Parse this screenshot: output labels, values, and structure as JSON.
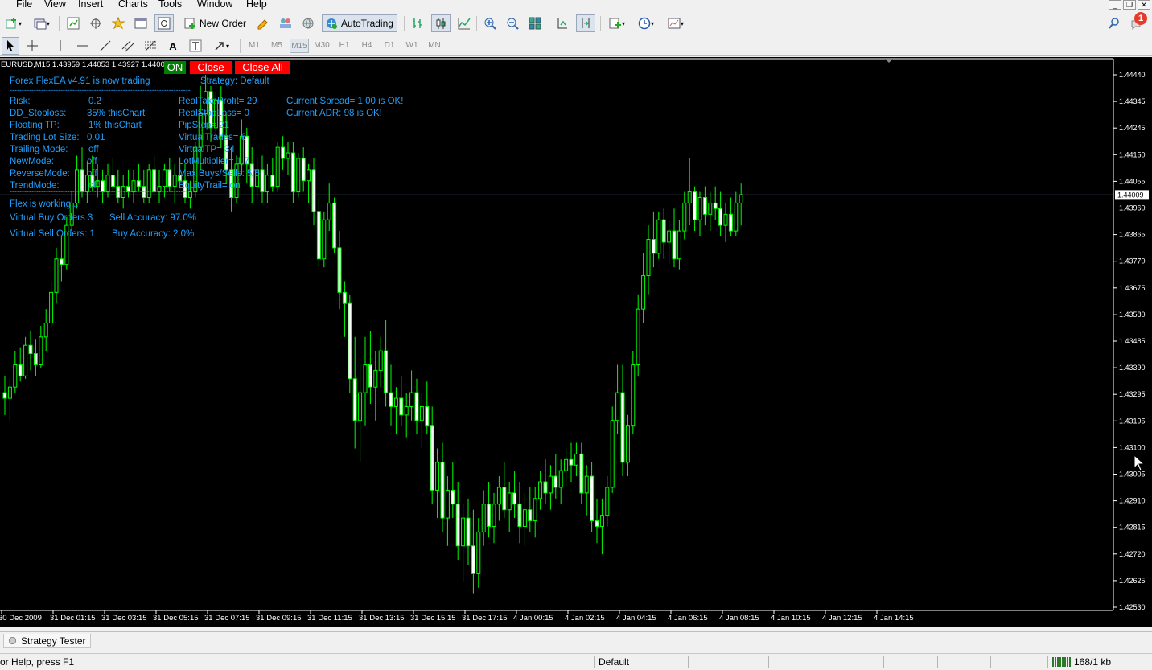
{
  "menu": [
    "File",
    "View",
    "Insert",
    "Charts",
    "Tools",
    "Window",
    "Help"
  ],
  "toolbar": {
    "new_order": "New Order",
    "autotrading": "AutoTrading",
    "timeframes": [
      "M1",
      "M5",
      "M15",
      "M30",
      "H1",
      "H4",
      "D1",
      "W1",
      "MN"
    ],
    "active_timeframe": "M15",
    "notification_count": "1"
  },
  "chart": {
    "header": "EURUSD,M15  1.43959 1.44053 1.43927 1.4400",
    "current_price": "1.44009",
    "price_labels": [
      "1.44440",
      "1.44345",
      "1.44245",
      "1.44150",
      "1.44055",
      "1.43960",
      "1.43865",
      "1.43770",
      "1.43675",
      "1.43580",
      "1.43485",
      "1.43390",
      "1.43295",
      "1.43195",
      "1.43100",
      "1.43005",
      "1.42910",
      "1.42815",
      "1.42720",
      "1.42625",
      "1.42530"
    ],
    "time_labels": [
      "30 Dec 2009",
      "31 Dec 01:15",
      "31 Dec 03:15",
      "31 Dec 05:15",
      "31 Dec 07:15",
      "31 Dec 09:15",
      "31 Dec 11:15",
      "31 Dec 13:15",
      "31 Dec 15:15",
      "31 Dec 17:15",
      "4 Jan 00:15",
      "4 Jan 02:15",
      "4 Jan 04:15",
      "4 Jan 06:15",
      "4 Jan 08:15",
      "4 Jan 10:15",
      "4 Jan 12:15",
      "4 Jan 14:15"
    ],
    "buttons": {
      "on": "ON",
      "close": "Close",
      "close_all": "Close All"
    }
  },
  "ea": {
    "title": "Forex FlexEA v4.91 is now trading",
    "strategy": "Strategy: Default",
    "divider": "---------------------------------------------------------------------------",
    "rows_left": [
      {
        "label": "Risk:",
        "value": "0.2"
      },
      {
        "label": "DD_Stoploss:",
        "value": "35%  thisChart"
      },
      {
        "label": "Floating TP:",
        "value": "1%  thisChart"
      },
      {
        "label": "Trading Lot Size:",
        "value": "0.01"
      },
      {
        "label": "Trailing Mode:",
        "value": "off"
      },
      {
        "label": "NewMode:",
        "value": "off"
      },
      {
        "label": "ReverseMode:",
        "value": "off"
      },
      {
        "label": "TrendMode:",
        "value": "off"
      }
    ],
    "rows_mid": [
      "RealTakeProfit= 29",
      "RealStopLoss= 0",
      "PipStep= 21",
      "VirtualTrades= 6",
      "VirtualTP= 34",
      "LotMultiplier= 1.7",
      "Max Buys/Sells: 5/5",
      "EquityTrail= on"
    ],
    "spread": "Current Spread= 1.00 is OK!",
    "adr": "Current ADR: 98  is OK!",
    "status": "Flex is working...",
    "vbuy": "Virtual Buy Orders 3",
    "sell_acc": "Sell Accuracy: 97.0%",
    "vsell": "Virtual Sell Orders: 1",
    "buy_acc": "Buy Accuracy: 2.0%"
  },
  "tester": {
    "label": "Strategy Tester"
  },
  "status": {
    "help": "or Help, press F1",
    "profile": "Default",
    "traffic": "168/1 kb"
  },
  "colors": {
    "bull": "#00ff00",
    "bear": "#ffffff",
    "text_cyan": "#1fa0ff",
    "on_bg": "#008000",
    "close_bg": "#ff0000"
  },
  "chart_data": {
    "type": "candlestick",
    "symbol": "EURUSD",
    "timeframe": "M15",
    "ylim": [
      1.4253,
      1.4444
    ],
    "last": 1.44009,
    "ohlc": [
      [
        1.433,
        1.4336,
        1.4322,
        1.4328
      ],
      [
        1.4328,
        1.4335,
        1.432,
        1.4332
      ],
      [
        1.4332,
        1.4345,
        1.433,
        1.434
      ],
      [
        1.434,
        1.4346,
        1.4334,
        1.4336
      ],
      [
        1.4336,
        1.435,
        1.4335,
        1.4347
      ],
      [
        1.4347,
        1.4352,
        1.4338,
        1.4344
      ],
      [
        1.4344,
        1.4349,
        1.4336,
        1.434
      ],
      [
        1.434,
        1.4354,
        1.4339,
        1.435
      ],
      [
        1.435,
        1.436,
        1.4345,
        1.4355
      ],
      [
        1.4355,
        1.437,
        1.4353,
        1.4366
      ],
      [
        1.4366,
        1.4382,
        1.4362,
        1.4378
      ],
      [
        1.4378,
        1.4386,
        1.437,
        1.4376
      ],
      [
        1.4376,
        1.4393,
        1.4374,
        1.439
      ],
      [
        1.439,
        1.4402,
        1.4388,
        1.4398
      ],
      [
        1.4398,
        1.4415,
        1.4396,
        1.441
      ],
      [
        1.441,
        1.4418,
        1.44,
        1.4402
      ],
      [
        1.4402,
        1.4413,
        1.4398,
        1.4408
      ],
      [
        1.4408,
        1.4415,
        1.4402,
        1.4404
      ],
      [
        1.4404,
        1.4412,
        1.44,
        1.4406
      ],
      [
        1.4406,
        1.441,
        1.4398,
        1.4402
      ],
      [
        1.4402,
        1.4412,
        1.44,
        1.4408
      ],
      [
        1.4408,
        1.4414,
        1.4402,
        1.4404
      ],
      [
        1.4404,
        1.441,
        1.4398,
        1.44
      ],
      [
        1.44,
        1.4408,
        1.4396,
        1.4404
      ],
      [
        1.4404,
        1.441,
        1.44,
        1.4402
      ],
      [
        1.4402,
        1.441,
        1.4398,
        1.4406
      ],
      [
        1.4406,
        1.4412,
        1.4402,
        1.4404
      ],
      [
        1.4404,
        1.441,
        1.4398,
        1.44
      ],
      [
        1.44,
        1.4412,
        1.4398,
        1.441
      ],
      [
        1.441,
        1.4415,
        1.44,
        1.4402
      ],
      [
        1.4402,
        1.441,
        1.4398,
        1.4404
      ],
      [
        1.4404,
        1.4412,
        1.44,
        1.441
      ],
      [
        1.441,
        1.4414,
        1.4402,
        1.4404
      ],
      [
        1.4404,
        1.4412,
        1.4398,
        1.4408
      ],
      [
        1.4408,
        1.4414,
        1.4404,
        1.4406
      ],
      [
        1.4406,
        1.4412,
        1.4398,
        1.44
      ],
      [
        1.44,
        1.4406,
        1.4396,
        1.4402
      ],
      [
        1.4402,
        1.442,
        1.44,
        1.4418
      ],
      [
        1.4418,
        1.444,
        1.441,
        1.443
      ],
      [
        1.443,
        1.4444,
        1.4425,
        1.4438
      ],
      [
        1.4438,
        1.444,
        1.442,
        1.4425
      ],
      [
        1.4425,
        1.4438,
        1.4422,
        1.4435
      ],
      [
        1.4435,
        1.444,
        1.4418,
        1.4422
      ],
      [
        1.4422,
        1.443,
        1.4405,
        1.441
      ],
      [
        1.441,
        1.4418,
        1.4395,
        1.44
      ],
      [
        1.44,
        1.4415,
        1.4398,
        1.4412
      ],
      [
        1.4412,
        1.4428,
        1.4408,
        1.4422
      ],
      [
        1.4422,
        1.4425,
        1.4405,
        1.4412
      ],
      [
        1.4412,
        1.4418,
        1.4398,
        1.4404
      ],
      [
        1.4404,
        1.4414,
        1.44,
        1.441
      ],
      [
        1.441,
        1.4415,
        1.4398,
        1.4402
      ],
      [
        1.4402,
        1.4412,
        1.4398,
        1.4408
      ],
      [
        1.4408,
        1.4414,
        1.4402,
        1.4404
      ],
      [
        1.4404,
        1.442,
        1.4402,
        1.4418
      ],
      [
        1.4418,
        1.4422,
        1.441,
        1.4414
      ],
      [
        1.4414,
        1.442,
        1.4408,
        1.4416
      ],
      [
        1.4416,
        1.442,
        1.4398,
        1.4402
      ],
      [
        1.4402,
        1.4416,
        1.44,
        1.4414
      ],
      [
        1.4414,
        1.4418,
        1.4402,
        1.4406
      ],
      [
        1.4406,
        1.4412,
        1.4398,
        1.441
      ],
      [
        1.441,
        1.4414,
        1.439,
        1.4395
      ],
      [
        1.4395,
        1.44,
        1.4375,
        1.4378
      ],
      [
        1.4378,
        1.4395,
        1.4375,
        1.4392
      ],
      [
        1.4392,
        1.4405,
        1.4388,
        1.4398
      ],
      [
        1.4398,
        1.44,
        1.438,
        1.4382
      ],
      [
        1.4382,
        1.4388,
        1.436,
        1.4366
      ],
      [
        1.4366,
        1.437,
        1.435,
        1.4362
      ],
      [
        1.4362,
        1.4365,
        1.433,
        1.4335
      ],
      [
        1.4335,
        1.435,
        1.431,
        1.432
      ],
      [
        1.432,
        1.434,
        1.4305,
        1.433
      ],
      [
        1.433,
        1.435,
        1.4318,
        1.434
      ],
      [
        1.434,
        1.4352,
        1.4326,
        1.4332
      ],
      [
        1.4332,
        1.4345,
        1.432,
        1.4338
      ],
      [
        1.4338,
        1.435,
        1.4332,
        1.4345
      ],
      [
        1.4345,
        1.4356,
        1.4325,
        1.433
      ],
      [
        1.433,
        1.434,
        1.4318,
        1.4325
      ],
      [
        1.4325,
        1.4332,
        1.4315,
        1.4328
      ],
      [
        1.4328,
        1.4336,
        1.4318,
        1.4322
      ],
      [
        1.4322,
        1.433,
        1.4314,
        1.4325
      ],
      [
        1.4325,
        1.4338,
        1.432,
        1.433
      ],
      [
        1.433,
        1.4335,
        1.4315,
        1.432
      ],
      [
        1.432,
        1.433,
        1.431,
        1.4325
      ],
      [
        1.4325,
        1.4334,
        1.4315,
        1.4318
      ],
      [
        1.4318,
        1.4325,
        1.429,
        1.4295
      ],
      [
        1.4295,
        1.431,
        1.4285,
        1.4305
      ],
      [
        1.4305,
        1.4312,
        1.428,
        1.4285
      ],
      [
        1.4285,
        1.43,
        1.4275,
        1.4295
      ],
      [
        1.4295,
        1.4305,
        1.4285,
        1.429
      ],
      [
        1.429,
        1.4298,
        1.427,
        1.4275
      ],
      [
        1.4275,
        1.429,
        1.4262,
        1.4285
      ],
      [
        1.4285,
        1.4292,
        1.4268,
        1.4275
      ],
      [
        1.4275,
        1.4288,
        1.4258,
        1.4265
      ],
      [
        1.4265,
        1.4285,
        1.426,
        1.428
      ],
      [
        1.428,
        1.4295,
        1.4275,
        1.429
      ],
      [
        1.429,
        1.4298,
        1.4278,
        1.4282
      ],
      [
        1.4282,
        1.4294,
        1.4276,
        1.429
      ],
      [
        1.429,
        1.43,
        1.4284,
        1.4296
      ],
      [
        1.4296,
        1.4305,
        1.4285,
        1.4288
      ],
      [
        1.4288,
        1.4298,
        1.428,
        1.4294
      ],
      [
        1.4294,
        1.4302,
        1.4285,
        1.429
      ],
      [
        1.429,
        1.4298,
        1.4276,
        1.4282
      ],
      [
        1.4282,
        1.4294,
        1.4275,
        1.4288
      ],
      [
        1.4288,
        1.4296,
        1.428,
        1.4284
      ],
      [
        1.4284,
        1.4296,
        1.4278,
        1.4292
      ],
      [
        1.4292,
        1.4302,
        1.4288,
        1.4298
      ],
      [
        1.4298,
        1.4306,
        1.429,
        1.4294
      ],
      [
        1.4294,
        1.4304,
        1.4288,
        1.43
      ],
      [
        1.43,
        1.4308,
        1.4292,
        1.4296
      ],
      [
        1.4296,
        1.4306,
        1.429,
        1.4302
      ],
      [
        1.4302,
        1.431,
        1.4296,
        1.4306
      ],
      [
        1.4306,
        1.4312,
        1.4298,
        1.4304
      ],
      [
        1.4304,
        1.4312,
        1.43,
        1.4308
      ],
      [
        1.4308,
        1.4312,
        1.429,
        1.4294
      ],
      [
        1.4294,
        1.4304,
        1.4286,
        1.43
      ],
      [
        1.43,
        1.4305,
        1.428,
        1.4284
      ],
      [
        1.4284,
        1.4292,
        1.4276,
        1.4282
      ],
      [
        1.4282,
        1.4292,
        1.4272,
        1.4286
      ],
      [
        1.4286,
        1.43,
        1.4282,
        1.4296
      ],
      [
        1.4296,
        1.4325,
        1.4294,
        1.432
      ],
      [
        1.432,
        1.434,
        1.4315,
        1.433
      ],
      [
        1.433,
        1.434,
        1.43,
        1.4305
      ],
      [
        1.4305,
        1.4322,
        1.43,
        1.4318
      ],
      [
        1.4318,
        1.4345,
        1.4315,
        1.434
      ],
      [
        1.434,
        1.4365,
        1.4336,
        1.436
      ],
      [
        1.436,
        1.438,
        1.4355,
        1.4372
      ],
      [
        1.4372,
        1.439,
        1.4365,
        1.4385
      ],
      [
        1.4385,
        1.4395,
        1.4375,
        1.438
      ],
      [
        1.438,
        1.4395,
        1.4378,
        1.4392
      ],
      [
        1.4392,
        1.4396,
        1.4378,
        1.4384
      ],
      [
        1.4384,
        1.4392,
        1.4376,
        1.4388
      ],
      [
        1.4388,
        1.4396,
        1.4375,
        1.4378
      ],
      [
        1.4378,
        1.4392,
        1.4374,
        1.4388
      ],
      [
        1.4388,
        1.4402,
        1.4385,
        1.4398
      ],
      [
        1.4398,
        1.4414,
        1.439,
        1.4402
      ],
      [
        1.4402,
        1.4404,
        1.4388,
        1.4392
      ],
      [
        1.4392,
        1.4402,
        1.4386,
        1.44
      ],
      [
        1.44,
        1.4404,
        1.439,
        1.4394
      ],
      [
        1.4394,
        1.4402,
        1.4388,
        1.4398
      ],
      [
        1.4398,
        1.4404,
        1.4392,
        1.4396
      ],
      [
        1.4396,
        1.4402,
        1.4386,
        1.439
      ],
      [
        1.439,
        1.4398,
        1.4384,
        1.4394
      ],
      [
        1.4394,
        1.44,
        1.4386,
        1.4388
      ],
      [
        1.4388,
        1.4402,
        1.4386,
        1.4398
      ],
      [
        1.4398,
        1.4405,
        1.439,
        1.4401
      ]
    ]
  }
}
